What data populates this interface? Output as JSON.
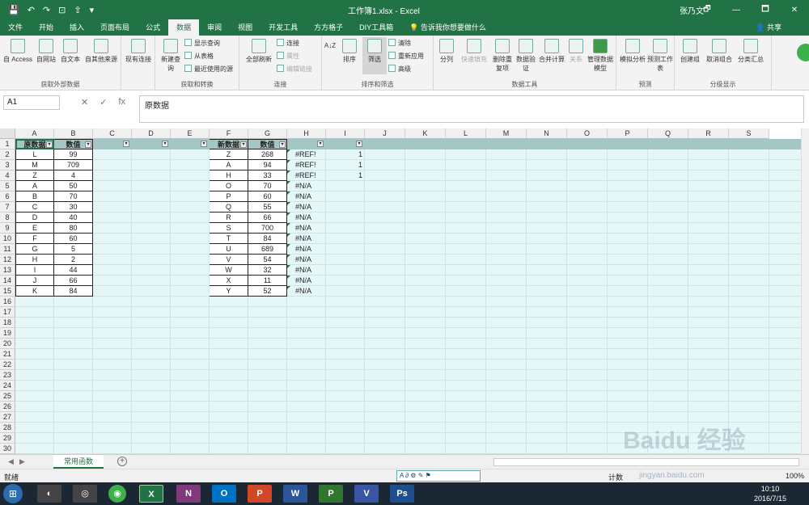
{
  "window": {
    "title": "工作簿1.xlsx - Excel",
    "user": "张乃文",
    "share": "共享",
    "controls": [
      "🗗",
      "—",
      "🗖",
      "✕"
    ]
  },
  "ribbon_tabs": [
    "文件",
    "开始",
    "插入",
    "页面布局",
    "公式",
    "数据",
    "审阅",
    "视图",
    "开发工具",
    "方方格子",
    "DIY工具箱"
  ],
  "active_tab": "数据",
  "tell_me": "告诉我你想要做什么",
  "ribbon": {
    "get_external": {
      "label": "获取外部数据",
      "buttons": [
        "自 Access",
        "自网站",
        "自文本",
        "自其他来源",
        "现有连接"
      ]
    },
    "get_transform": {
      "label": "获取和转换",
      "new_query": "新建查询",
      "small": [
        "显示查询",
        "从表格",
        "最近使用的源"
      ]
    },
    "connections": {
      "label": "连接",
      "refresh_all": "全部刷新",
      "small": [
        "连接",
        "属性",
        "编辑链接"
      ]
    },
    "sort_filter": {
      "label": "排序和筛选",
      "sort": "排序",
      "filter": "筛选",
      "small": [
        "清除",
        "重新应用",
        "高级"
      ]
    },
    "data_tools": {
      "label": "数据工具",
      "buttons": [
        "分列",
        "快速填充",
        "删除重复项",
        "数据验证",
        "合并计算",
        "关系",
        "管理数据模型"
      ]
    },
    "forecast": {
      "label": "预测",
      "buttons": [
        "模拟分析",
        "预测工作表"
      ]
    },
    "outline": {
      "label": "分级显示",
      "buttons": [
        "创建组",
        "取消组合",
        "分类汇总"
      ]
    }
  },
  "formula_bar": {
    "name_box": "A1",
    "fx": "fx",
    "content": "原数据"
  },
  "columns": [
    "A",
    "B",
    "C",
    "D",
    "E",
    "F",
    "G",
    "H",
    "I",
    "J",
    "K",
    "L",
    "M",
    "N",
    "O",
    "P",
    "Q",
    "R",
    "S"
  ],
  "rows": [
    "1",
    "2",
    "3",
    "4",
    "5",
    "6",
    "7",
    "8",
    "9",
    "10",
    "11",
    "12",
    "13",
    "14",
    "15",
    "16",
    "17",
    "18",
    "19",
    "20",
    "21",
    "22",
    "23",
    "24",
    "25",
    "26",
    "27",
    "28",
    "29",
    "30"
  ],
  "table1": {
    "headers": [
      "原数据",
      "数值"
    ],
    "rows": [
      [
        "L",
        "99"
      ],
      [
        "M",
        "709"
      ],
      [
        "Z",
        "4"
      ],
      [
        "A",
        "50"
      ],
      [
        "B",
        "70"
      ],
      [
        "C",
        "30"
      ],
      [
        "D",
        "40"
      ],
      [
        "E",
        "80"
      ],
      [
        "F",
        "60"
      ],
      [
        "G",
        "5"
      ],
      [
        "H",
        "2"
      ],
      [
        "I",
        "44"
      ],
      [
        "J",
        "66"
      ],
      [
        "K",
        "84"
      ]
    ]
  },
  "table2": {
    "headers": [
      "新数据",
      "数值"
    ],
    "rows": [
      [
        "Z",
        "268"
      ],
      [
        "A",
        "94"
      ],
      [
        "H",
        "33"
      ],
      [
        "O",
        "70"
      ],
      [
        "P",
        "60"
      ],
      [
        "Q",
        "55"
      ],
      [
        "R",
        "66"
      ],
      [
        "S",
        "700"
      ],
      [
        "T",
        "84"
      ],
      [
        "U",
        "689"
      ],
      [
        "V",
        "54"
      ],
      [
        "W",
        "32"
      ],
      [
        "X",
        "11"
      ],
      [
        "Y",
        "52"
      ]
    ]
  },
  "col_h": [
    "#REF!",
    "#REF!",
    "#REF!",
    "#N/A",
    "#N/A",
    "#N/A",
    "#N/A",
    "#N/A",
    "#N/A",
    "#N/A",
    "#N/A",
    "#N/A",
    "#N/A",
    "#N/A"
  ],
  "col_i": [
    "1",
    "1",
    "1"
  ],
  "sheet_tab": "常用函数",
  "add_sheet": "+",
  "status": {
    "ready": "就绪",
    "count": "计数",
    "zoom": "100%"
  },
  "ime_bar": "A ∂ ⚙ ✎ ⚑",
  "taskbar": {
    "apps": [
      {
        "label": "N",
        "color": "#80397b"
      },
      {
        "label": "O",
        "color": "#0072c6"
      },
      {
        "label": "P",
        "color": "#d24726"
      },
      {
        "label": "W",
        "color": "#2b579a"
      },
      {
        "label": "P",
        "color": "#31752f"
      },
      {
        "label": "V",
        "color": "#3955a3"
      },
      {
        "label": "Ps",
        "color": "#1e4e8c"
      }
    ],
    "time": "10:10",
    "date": "2016/7/15"
  },
  "watermark": "Baidu 经验",
  "watermark_url": "jingyan.baidu.com",
  "colors": {
    "excel_green": "#217346",
    "table_header": "#a3c7c5",
    "sheet_bg": "#e6f7f8"
  }
}
